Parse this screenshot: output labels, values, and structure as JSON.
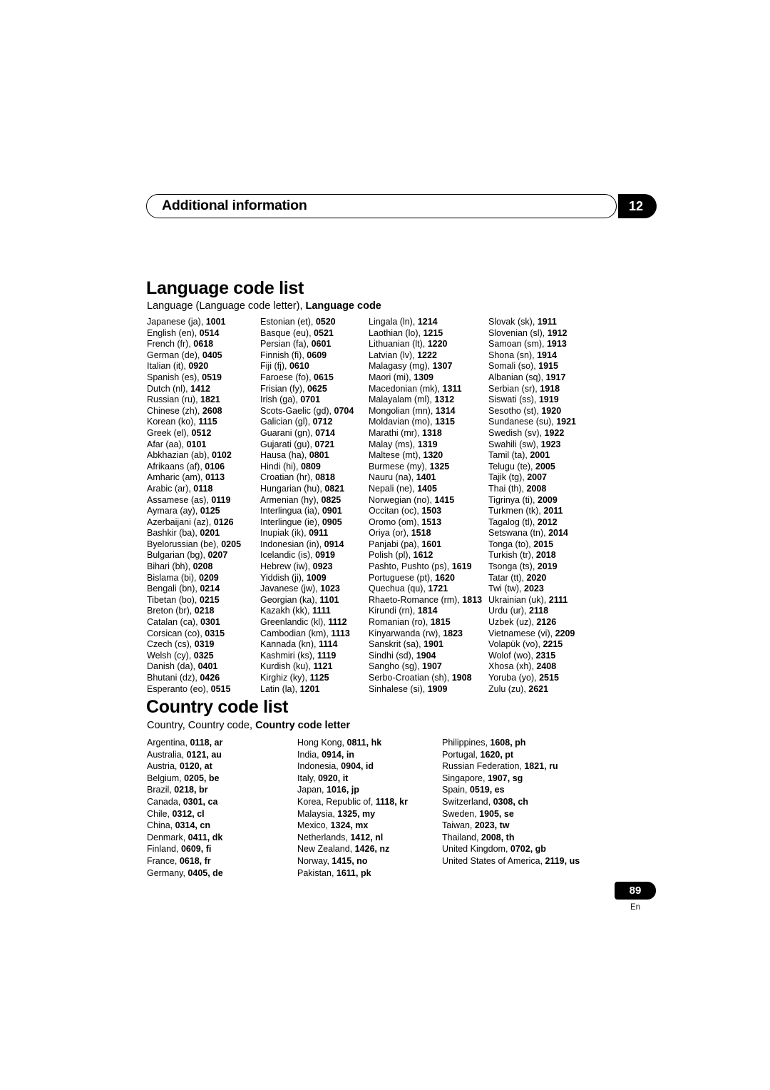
{
  "header": {
    "title": "Additional information",
    "chapter": "12"
  },
  "language_section": {
    "title": "Language code list",
    "subtitle_plain": "Language (Language code letter), ",
    "subtitle_bold": "Language code",
    "columns": [
      [
        {
          "name": "Japanese (ja), ",
          "code": "1001"
        },
        {
          "name": "English (en), ",
          "code": "0514"
        },
        {
          "name": "French (fr), ",
          "code": "0618"
        },
        {
          "name": "German (de), ",
          "code": "0405"
        },
        {
          "name": "Italian (it), ",
          "code": "0920"
        },
        {
          "name": "Spanish (es), ",
          "code": "0519"
        },
        {
          "name": "Dutch (nl), ",
          "code": "1412"
        },
        {
          "name": "Russian (ru), ",
          "code": "1821"
        },
        {
          "name": "Chinese (zh), ",
          "code": "2608"
        },
        {
          "name": "Korean (ko), ",
          "code": "1115"
        },
        {
          "name": "Greek (el), ",
          "code": "0512"
        },
        {
          "name": "Afar (aa), ",
          "code": "0101"
        },
        {
          "name": "Abkhazian (ab), ",
          "code": "0102"
        },
        {
          "name": "Afrikaans (af), ",
          "code": "0106"
        },
        {
          "name": "Amharic (am), ",
          "code": "0113"
        },
        {
          "name": "Arabic (ar), ",
          "code": "0118"
        },
        {
          "name": "Assamese (as), ",
          "code": "0119"
        },
        {
          "name": "Aymara (ay), ",
          "code": "0125"
        },
        {
          "name": "Azerbaijani (az), ",
          "code": "0126"
        },
        {
          "name": "Bashkir (ba), ",
          "code": "0201"
        },
        {
          "name": "Byelorussian (be), ",
          "code": "0205"
        },
        {
          "name": "Bulgarian (bg), ",
          "code": "0207"
        },
        {
          "name": "Bihari (bh), ",
          "code": "0208"
        },
        {
          "name": "Bislama (bi), ",
          "code": "0209"
        },
        {
          "name": "Bengali (bn), ",
          "code": "0214"
        },
        {
          "name": "Tibetan (bo), ",
          "code": "0215"
        },
        {
          "name": "Breton (br), ",
          "code": "0218"
        },
        {
          "name": "Catalan (ca), ",
          "code": "0301"
        },
        {
          "name": "Corsican (co), ",
          "code": "0315"
        },
        {
          "name": "Czech (cs), ",
          "code": "0319"
        },
        {
          "name": "Welsh (cy), ",
          "code": "0325"
        },
        {
          "name": "Danish (da), ",
          "code": "0401"
        },
        {
          "name": "Bhutani (dz), ",
          "code": "0426"
        },
        {
          "name": "Esperanto (eo), ",
          "code": "0515"
        }
      ],
      [
        {
          "name": "Estonian (et), ",
          "code": "0520"
        },
        {
          "name": "Basque (eu), ",
          "code": "0521"
        },
        {
          "name": "Persian (fa), ",
          "code": "0601"
        },
        {
          "name": "Finnish (fi), ",
          "code": "0609"
        },
        {
          "name": "Fiji (fj), ",
          "code": "0610"
        },
        {
          "name": "Faroese (fo), ",
          "code": "0615"
        },
        {
          "name": "Frisian (fy), ",
          "code": "0625"
        },
        {
          "name": "Irish (ga), ",
          "code": "0701"
        },
        {
          "name": "Scots-Gaelic (gd), ",
          "code": "0704"
        },
        {
          "name": "Galician (gl), ",
          "code": "0712"
        },
        {
          "name": "Guarani (gn), ",
          "code": "0714"
        },
        {
          "name": "Gujarati (gu), ",
          "code": "0721"
        },
        {
          "name": "Hausa (ha), ",
          "code": "0801"
        },
        {
          "name": "Hindi (hi), ",
          "code": "0809"
        },
        {
          "name": "Croatian (hr), ",
          "code": "0818"
        },
        {
          "name": "Hungarian (hu), ",
          "code": "0821"
        },
        {
          "name": "Armenian (hy), ",
          "code": "0825"
        },
        {
          "name": "Interlingua (ia), ",
          "code": "0901"
        },
        {
          "name": "Interlingue (ie), ",
          "code": "0905"
        },
        {
          "name": "Inupiak (ik), ",
          "code": "0911"
        },
        {
          "name": "Indonesian (in), ",
          "code": "0914"
        },
        {
          "name": "Icelandic (is), ",
          "code": "0919"
        },
        {
          "name": "Hebrew (iw), ",
          "code": "0923"
        },
        {
          "name": "Yiddish (ji), ",
          "code": "1009"
        },
        {
          "name": "Javanese (jw), ",
          "code": "1023"
        },
        {
          "name": "Georgian (ka), ",
          "code": "1101"
        },
        {
          "name": "Kazakh (kk), ",
          "code": "1111"
        },
        {
          "name": "Greenlandic (kl), ",
          "code": "1112"
        },
        {
          "name": "Cambodian (km), ",
          "code": "1113"
        },
        {
          "name": "Kannada (kn), ",
          "code": "1114"
        },
        {
          "name": "Kashmiri (ks), ",
          "code": "1119"
        },
        {
          "name": "Kurdish (ku), ",
          "code": "1121"
        },
        {
          "name": "Kirghiz (ky), ",
          "code": "1125"
        },
        {
          "name": "Latin (la), ",
          "code": "1201"
        }
      ],
      [
        {
          "name": "Lingala (ln), ",
          "code": "1214"
        },
        {
          "name": "Laothian (lo), ",
          "code": "1215"
        },
        {
          "name": "Lithuanian (lt), ",
          "code": "1220"
        },
        {
          "name": "Latvian (lv), ",
          "code": "1222"
        },
        {
          "name": "Malagasy (mg), ",
          "code": "1307"
        },
        {
          "name": "Maori (mi), ",
          "code": "1309"
        },
        {
          "name": "Macedonian (mk), ",
          "code": "1311"
        },
        {
          "name": "Malayalam (ml), ",
          "code": "1312"
        },
        {
          "name": "Mongolian (mn), ",
          "code": "1314"
        },
        {
          "name": "Moldavian (mo), ",
          "code": "1315"
        },
        {
          "name": "Marathi (mr), ",
          "code": "1318"
        },
        {
          "name": "Malay (ms), ",
          "code": "1319"
        },
        {
          "name": "Maltese (mt), ",
          "code": "1320"
        },
        {
          "name": "Burmese (my), ",
          "code": "1325"
        },
        {
          "name": "Nauru (na), ",
          "code": "1401"
        },
        {
          "name": "Nepali (ne), ",
          "code": "1405"
        },
        {
          "name": "Norwegian (no), ",
          "code": "1415"
        },
        {
          "name": "Occitan (oc), ",
          "code": "1503"
        },
        {
          "name": "Oromo (om), ",
          "code": "1513"
        },
        {
          "name": "Oriya (or), ",
          "code": "1518"
        },
        {
          "name": "Panjabi (pa), ",
          "code": "1601"
        },
        {
          "name": "Polish (pl), ",
          "code": "1612"
        },
        {
          "name": "Pashto, Pushto (ps), ",
          "code": "1619"
        },
        {
          "name": "Portuguese (pt), ",
          "code": "1620"
        },
        {
          "name": "Quechua (qu), ",
          "code": "1721"
        },
        {
          "name": "Rhaeto-Romance (rm), ",
          "code": "1813"
        },
        {
          "name": "Kirundi (rn), ",
          "code": "1814"
        },
        {
          "name": "Romanian (ro), ",
          "code": "1815"
        },
        {
          "name": "Kinyarwanda (rw), ",
          "code": "1823"
        },
        {
          "name": "Sanskrit (sa), ",
          "code": "1901"
        },
        {
          "name": "Sindhi (sd), ",
          "code": "1904"
        },
        {
          "name": "Sangho (sg), ",
          "code": "1907"
        },
        {
          "name": "Serbo-Croatian (sh), ",
          "code": "1908"
        },
        {
          "name": "Sinhalese (si), ",
          "code": "1909"
        }
      ],
      [
        {
          "name": "Slovak (sk), ",
          "code": "1911"
        },
        {
          "name": "Slovenian (sl), ",
          "code": "1912"
        },
        {
          "name": "Samoan (sm), ",
          "code": "1913"
        },
        {
          "name": "Shona (sn), ",
          "code": "1914"
        },
        {
          "name": "Somali (so), ",
          "code": "1915"
        },
        {
          "name": "Albanian (sq), ",
          "code": "1917"
        },
        {
          "name": "Serbian (sr), ",
          "code": "1918"
        },
        {
          "name": "Siswati (ss), ",
          "code": "1919"
        },
        {
          "name": "Sesotho (st), ",
          "code": "1920"
        },
        {
          "name": "Sundanese (su), ",
          "code": "1921"
        },
        {
          "name": "Swedish (sv), ",
          "code": "1922"
        },
        {
          "name": "Swahili (sw), ",
          "code": "1923"
        },
        {
          "name": "Tamil (ta), ",
          "code": "2001"
        },
        {
          "name": "Telugu (te), ",
          "code": "2005"
        },
        {
          "name": "Tajik (tg), ",
          "code": "2007"
        },
        {
          "name": "Thai (th), ",
          "code": "2008"
        },
        {
          "name": "Tigrinya (ti), ",
          "code": "2009"
        },
        {
          "name": "Turkmen (tk), ",
          "code": "2011"
        },
        {
          "name": "Tagalog (tl), ",
          "code": "2012"
        },
        {
          "name": "Setswana (tn), ",
          "code": "2014"
        },
        {
          "name": "Tonga (to), ",
          "code": "2015"
        },
        {
          "name": "Turkish (tr), ",
          "code": "2018"
        },
        {
          "name": "Tsonga (ts), ",
          "code": "2019"
        },
        {
          "name": "Tatar (tt), ",
          "code": "2020"
        },
        {
          "name": "Twi (tw), ",
          "code": "2023"
        },
        {
          "name": "Ukrainian (uk), ",
          "code": "2111"
        },
        {
          "name": "Urdu (ur), ",
          "code": "2118"
        },
        {
          "name": "Uzbek (uz), ",
          "code": "2126"
        },
        {
          "name": "Vietnamese (vi), ",
          "code": "2209"
        },
        {
          "name": "Volapük (vo), ",
          "code": "2215"
        },
        {
          "name": "Wolof (wo), ",
          "code": "2315"
        },
        {
          "name": "Xhosa (xh), ",
          "code": "2408"
        },
        {
          "name": "Yoruba (yo), ",
          "code": "2515"
        },
        {
          "name": "Zulu (zu), ",
          "code": "2621"
        }
      ]
    ]
  },
  "country_section": {
    "title": "Country code list",
    "subtitle_plain": "Country, Country code, ",
    "subtitle_bold": "Country code letter",
    "columns": [
      [
        {
          "name": "Argentina, ",
          "code": "0118, ar"
        },
        {
          "name": "Australia, ",
          "code": "0121, au"
        },
        {
          "name": "Austria, ",
          "code": "0120, at"
        },
        {
          "name": "Belgium, ",
          "code": "0205, be"
        },
        {
          "name": "Brazil, ",
          "code": "0218, br"
        },
        {
          "name": "Canada, ",
          "code": "0301, ca"
        },
        {
          "name": "Chile, ",
          "code": "0312, cl"
        },
        {
          "name": "China, ",
          "code": "0314, cn"
        },
        {
          "name": "Denmark, ",
          "code": "0411, dk"
        },
        {
          "name": "Finland, ",
          "code": "0609, fi"
        },
        {
          "name": "France, ",
          "code": "0618, fr"
        },
        {
          "name": "Germany, ",
          "code": "0405, de"
        }
      ],
      [
        {
          "name": "Hong Kong, ",
          "code": "0811, hk"
        },
        {
          "name": "India, ",
          "code": "0914, in"
        },
        {
          "name": "Indonesia, ",
          "code": "0904, id"
        },
        {
          "name": "Italy, ",
          "code": "0920, it"
        },
        {
          "name": "Japan, ",
          "code": "1016, jp"
        },
        {
          "name": "Korea, Republic of, ",
          "code": "1118, kr"
        },
        {
          "name": "Malaysia, ",
          "code": "1325, my"
        },
        {
          "name": "Mexico, ",
          "code": "1324, mx"
        },
        {
          "name": "Netherlands, ",
          "code": "1412, nl"
        },
        {
          "name": "New Zealand, ",
          "code": "1426, nz"
        },
        {
          "name": "Norway, ",
          "code": "1415, no"
        },
        {
          "name": "Pakistan, ",
          "code": "1611, pk"
        }
      ],
      [
        {
          "name": "Philippines, ",
          "code": "1608, ph"
        },
        {
          "name": "Portugal, ",
          "code": "1620, pt"
        },
        {
          "name": "Russian Federation, ",
          "code": "1821, ru"
        },
        {
          "name": "Singapore, ",
          "code": "1907, sg"
        },
        {
          "name": "Spain, ",
          "code": "0519, es"
        },
        {
          "name": "Switzerland, ",
          "code": "0308, ch"
        },
        {
          "name": "Sweden, ",
          "code": "1905, se"
        },
        {
          "name": "Taiwan, ",
          "code": "2023, tw"
        },
        {
          "name": "Thailand, ",
          "code": "2008, th"
        },
        {
          "name": "United Kingdom, ",
          "code": "0702, gb"
        },
        {
          "name": "United States of America, ",
          "code": "2119, us"
        }
      ]
    ]
  },
  "footer": {
    "page_number": "89",
    "language_mark": "En"
  }
}
